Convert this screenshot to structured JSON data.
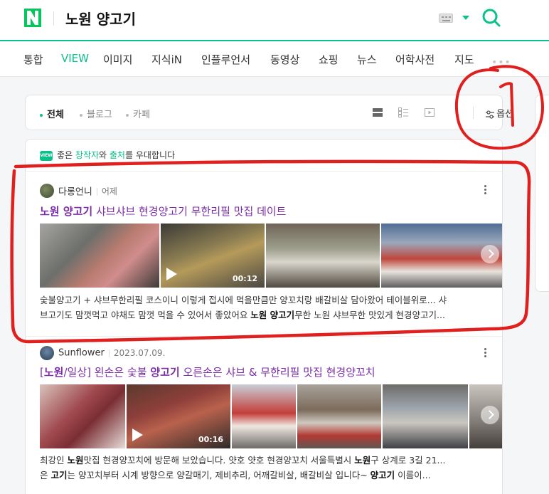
{
  "header": {
    "logo_letter": "N",
    "query": "노원 양고기",
    "brand_color": "#0bc08a"
  },
  "tabs": [
    {
      "label": "통합",
      "active": false
    },
    {
      "label": "VIEW",
      "active": true
    },
    {
      "label": "이미지",
      "active": false
    },
    {
      "label": "지식iN",
      "active": false
    },
    {
      "label": "인플루언서",
      "active": false
    },
    {
      "label": "동영상",
      "active": false
    },
    {
      "label": "쇼핑",
      "active": false
    },
    {
      "label": "뉴스",
      "active": false
    },
    {
      "label": "어학사전",
      "active": false
    },
    {
      "label": "지도",
      "active": false
    }
  ],
  "tab_more": "•••",
  "filters": {
    "items": [
      {
        "label": "전체",
        "active": true
      },
      {
        "label": "블로그",
        "active": false
      },
      {
        "label": "카페",
        "active": false
      }
    ],
    "options_label": "옵션"
  },
  "notice": {
    "badge": "VIEW",
    "before": "좋은 ",
    "creator": "창작자",
    "mid": "와 ",
    "source": "출처",
    "after": "를 우대합니다"
  },
  "posts": [
    {
      "author": "다롱언니",
      "date": "어제",
      "title_bold": "노원 양고기",
      "title_rest": " 샤브샤브 현경양고기 무한리필 맛집 데이트",
      "video_duration": "00:12",
      "snippet_line1": "숯불양고기 + 샤브무한리필 코스이니 이렇게 접시에 먹을만큼만 양꼬치랑 배갈비살 담아왔어 테이블위로... 샤",
      "snippet_line2_a": "브고기도 맘껏먹고 야채도 맘껏 먹을 수 있어서 좋았어요 ",
      "snippet_line2_bold": "노원 양고기",
      "snippet_line2_b": "무한 노원 샤브무한 맛있게 현경양고기..."
    },
    {
      "author": "Sunflower",
      "date": "2023.07.09.",
      "title_a": "[",
      "title_bold1": "노원",
      "title_b": "/일상] 왼손은 숯불 ",
      "title_bold2": "양고기",
      "title_c": " 오른손은 샤브 & 무한리필 맛집 현경양꼬치",
      "video_duration": "00:16",
      "snippet_line1_a": "최강인 ",
      "snippet_line1_bold1": "노원",
      "snippet_line1_b": "맛집 현경양꼬치에 방문해 보았습니다. 얏호 얏호 현경양꼬치 서울특별시 ",
      "snippet_line1_bold2": "노원",
      "snippet_line1_c": "구 상계로 3길 21...",
      "snippet_line2_a": "은 ",
      "snippet_line2_bold1": "고기",
      "snippet_line2_b": "는 양꼬치부터 시계 방향으로 양갈매기, 제비추리, 어깨갈비살, 배갈비살 입니다~ ",
      "snippet_line2_bold2": "양고기",
      "snippet_line2_c": " 이름이..."
    }
  ],
  "annotations": {
    "label": "1",
    "color": "#e01f1f"
  }
}
